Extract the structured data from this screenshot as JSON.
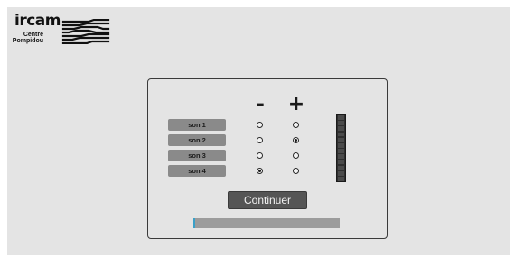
{
  "logo": {
    "word": "ircam",
    "line1": "Centre",
    "line2": "Pompidou"
  },
  "columns": {
    "minus": "-",
    "plus": "+"
  },
  "sons": [
    {
      "label": "son 1",
      "selected": "none"
    },
    {
      "label": "son 2",
      "selected": "plus"
    },
    {
      "label": "son 3",
      "selected": "none"
    },
    {
      "label": "son 4",
      "selected": "minus"
    }
  ],
  "meter": {
    "segments": 12,
    "level": 0
  },
  "continue_label": "Continuer",
  "progress": {
    "fraction": 0.01
  },
  "colors": {
    "accent": "#3aa0c8",
    "panel_bg": "#e4e4e4"
  }
}
